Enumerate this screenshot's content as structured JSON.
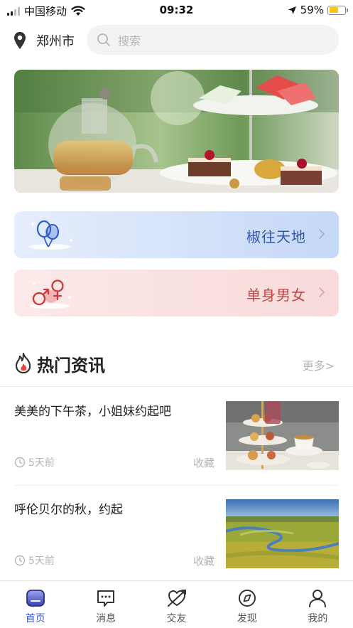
{
  "status_bar": {
    "carrier": "中国移动",
    "time": "09:32",
    "battery_percent": "59%",
    "battery_level": 0.59
  },
  "header": {
    "city": "郑州市",
    "search_placeholder": "搜索"
  },
  "categories": [
    {
      "label": "椒往天地",
      "icon": "balloons-icon"
    },
    {
      "label": "单身男女",
      "icon": "gender-symbols-icon"
    }
  ],
  "section": {
    "title": "热门资讯",
    "more": "更多>"
  },
  "news": [
    {
      "title": "美美的下午茶，小姐妹约起吧",
      "time": "5天前",
      "fav": "收藏",
      "image": "afternoon-tea-photo"
    },
    {
      "title": "呼伦贝尔的秋，约起",
      "time": "5天前",
      "fav": "收藏",
      "image": "grassland-river-photo"
    }
  ],
  "tabs": [
    {
      "label": "首页",
      "icon": "home-icon",
      "active": true
    },
    {
      "label": "消息",
      "icon": "message-icon",
      "active": false
    },
    {
      "label": "交友",
      "icon": "dating-icon",
      "active": false
    },
    {
      "label": "发现",
      "icon": "compass-icon",
      "active": false
    },
    {
      "label": "我的",
      "icon": "profile-icon",
      "active": false
    }
  ],
  "colors": {
    "accent": "#3a5bd0",
    "blue_card_text": "#2f56a8",
    "pink_card_text": "#bd4545",
    "battery": "#f5c518"
  }
}
